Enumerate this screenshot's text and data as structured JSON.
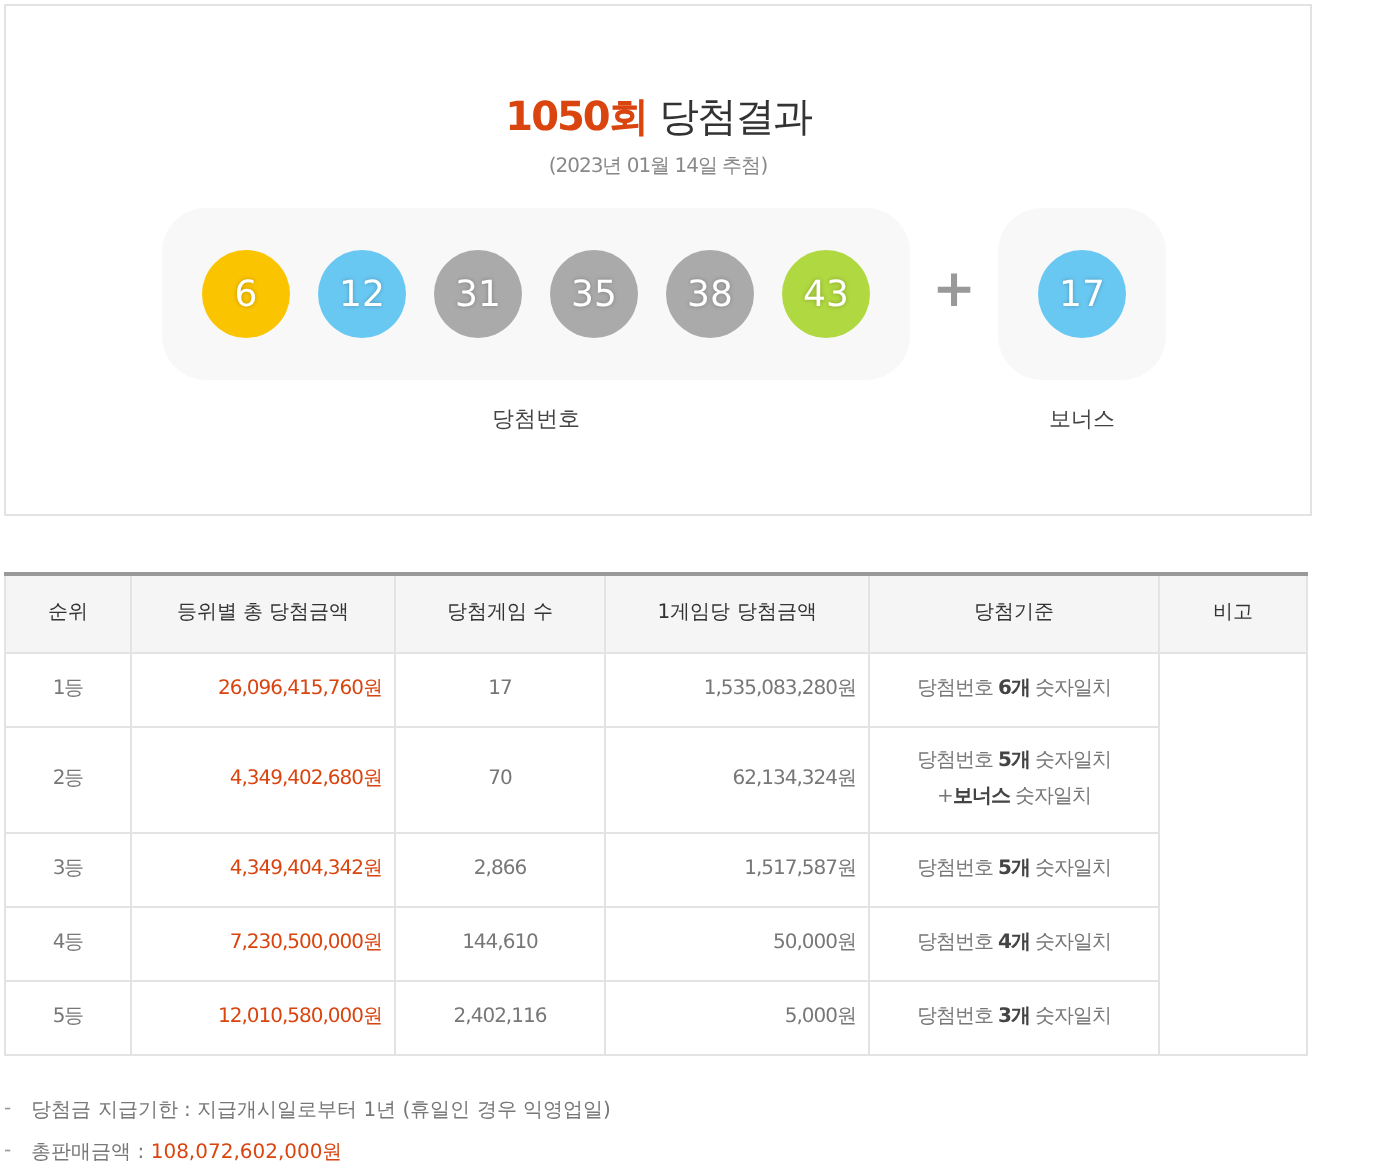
{
  "result": {
    "round": "1050회",
    "title": "당첨결과",
    "date": "(2023년 01월 14일 추첨)",
    "numbers": [
      {
        "value": "6",
        "color": "#fbc400"
      },
      {
        "value": "12",
        "color": "#69c8f2"
      },
      {
        "value": "31",
        "color": "#aaaaaa"
      },
      {
        "value": "35",
        "color": "#aaaaaa"
      },
      {
        "value": "38",
        "color": "#aaaaaa"
      },
      {
        "value": "43",
        "color": "#b0d840"
      }
    ],
    "plus": "+",
    "bonus": {
      "value": "17",
      "color": "#69c8f2"
    },
    "numbers_label": "당첨번호",
    "bonus_label": "보너스"
  },
  "table": {
    "columns": [
      "순위",
      "등위별 총 당첨금액",
      "당첨게임 수",
      "1게임당 당첨금액",
      "당첨기준",
      "비고"
    ],
    "rows": [
      {
        "rank": "1등",
        "total": "26,096,415,760원",
        "games": "17",
        "per_game": "1,535,083,280원",
        "criteria": [
          "당첨번호 **6개** 숫자일치"
        ]
      },
      {
        "rank": "2등",
        "total": "4,349,402,680원",
        "games": "70",
        "per_game": "62,134,324원",
        "criteria": [
          "당첨번호 **5개** 숫자일치",
          "+**보너스** 숫자일치"
        ]
      },
      {
        "rank": "3등",
        "total": "4,349,404,342원",
        "games": "2,866",
        "per_game": "1,517,587원",
        "criteria": [
          "당첨번호 **5개** 숫자일치"
        ]
      },
      {
        "rank": "4등",
        "total": "7,230,500,000원",
        "games": "144,610",
        "per_game": "50,000원",
        "criteria": [
          "당첨번호 **4개** 숫자일치"
        ]
      },
      {
        "rank": "5등",
        "total": "12,010,580,000원",
        "games": "2,402,116",
        "per_game": "5,000원",
        "criteria": [
          "당첨번호 **3개** 숫자일치"
        ]
      }
    ]
  },
  "notes": [
    {
      "marker": "-",
      "label": "당첨금 지급기한 : ",
      "value": "지급개시일로부터 1년 (휴일인 경우 익영업일)",
      "highlight": false
    },
    {
      "marker": "-",
      "label": "총판매금액 : ",
      "value": "108,072,602,000원",
      "highlight": true
    }
  ]
}
